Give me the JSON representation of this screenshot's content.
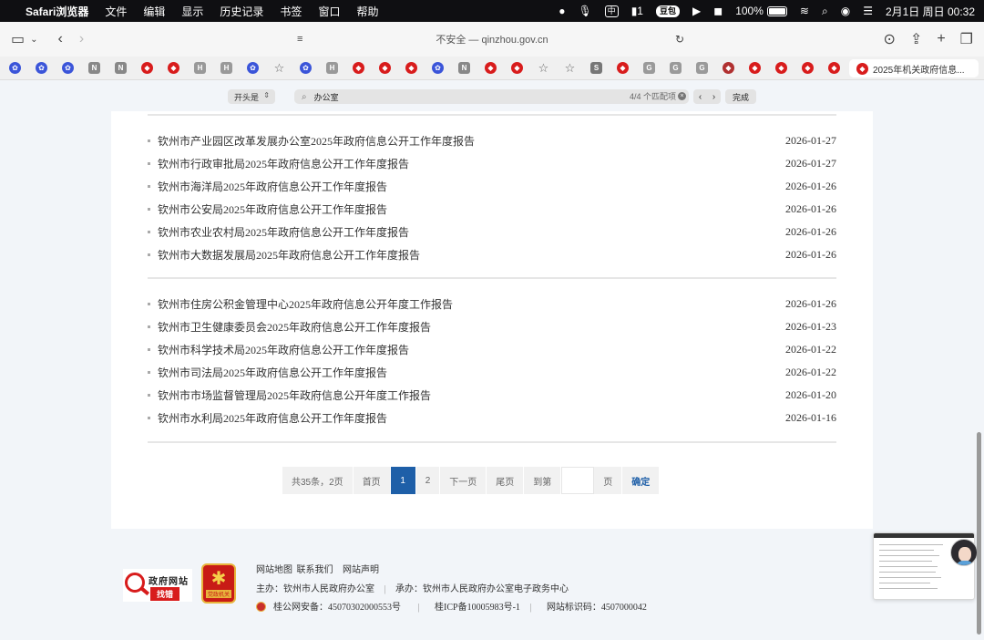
{
  "menubar": {
    "app": "Safari浏览器",
    "menus": [
      "文件",
      "编辑",
      "显示",
      "历史记录",
      "书签",
      "窗口",
      "帮助"
    ],
    "status": {
      "ime": "中",
      "notif_count": "1",
      "douban": "豆包",
      "battery": "100%",
      "datetime": "2月1日 周日  00:32"
    }
  },
  "toolbar": {
    "address": "不安全 — qinzhou.gov.cn"
  },
  "favorites": {
    "active_tab_label": "2025年机关政府信息..."
  },
  "findbar": {
    "prefix_mode": "开头是",
    "query": "办公室",
    "match_count": "4/4 个匹配项",
    "done_label": "完成"
  },
  "list_groups": [
    [
      {
        "title": "钦州市产业园区改革发展办公室2025年政府信息公开工作年度报告",
        "date": "2026-01-27"
      },
      {
        "title": "钦州市行政审批局2025年政府信息公开工作年度报告",
        "date": "2026-01-27"
      },
      {
        "title": "钦州市海洋局2025年政府信息公开工作年度报告",
        "date": "2026-01-26"
      },
      {
        "title": "钦州市公安局2025年政府信息公开工作年度报告",
        "date": "2026-01-26"
      },
      {
        "title": "钦州市农业农村局2025年政府信息公开工作年度报告",
        "date": "2026-01-26"
      },
      {
        "title": "钦州市大数据发展局2025年政府信息公开工作年度报告",
        "date": "2026-01-26"
      }
    ],
    [
      {
        "title": "钦州市住房公积金管理中心2025年政府信息公开年度工作报告",
        "date": "2026-01-26"
      },
      {
        "title": "钦州市卫生健康委员会2025年政府信息公开工作年度报告",
        "date": "2026-01-23"
      },
      {
        "title": "钦州市科学技术局2025年政府信息公开工作年度报告",
        "date": "2026-01-22"
      },
      {
        "title": "钦州市司法局2025年政府信息公开工作年度报告",
        "date": "2026-01-22"
      },
      {
        "title": "钦州市市场监督管理局2025年政府信息公开年度工作报告",
        "date": "2026-01-20"
      },
      {
        "title": "钦州市水利局2025年政府信息公开工作年度报告",
        "date": "2026-01-16"
      }
    ]
  ],
  "pagination": {
    "summary": "共35条，2页",
    "first": "首页",
    "current_page": "1",
    "page2": "2",
    "next": "下一页",
    "last": "尾页",
    "goto": "到第",
    "goto_value": "",
    "page_unit": "页",
    "confirm": "确定"
  },
  "footer": {
    "links": [
      "网站地图",
      "联系我们",
      "网站声明"
    ],
    "sponsor": "主办：钦州市人民政府办公室",
    "organizer": "承办：钦州市人民政府办公室电子政务中心",
    "police_record": "桂公网安备：45070302000553号",
    "icp": "桂ICP备10005983号-1",
    "site_code": "网站标识码：4507000042",
    "gov_logo_title": "政府网站",
    "gov_logo_sub": "找错",
    "party_logo_label": "党政机关"
  }
}
